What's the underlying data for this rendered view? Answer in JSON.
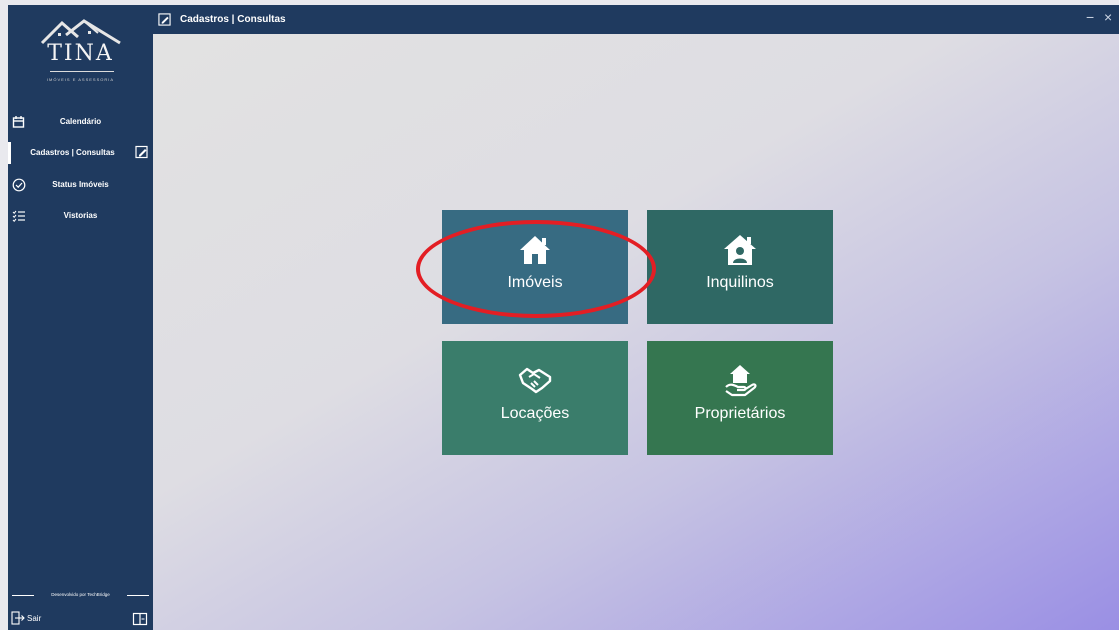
{
  "app": {
    "logo_text": "TINA",
    "logo_subtitle": "IMÓVEIS E ASSESSORIA",
    "window_title": "Cadastros | Consultas",
    "min_symbol": "−",
    "close_symbol": "×"
  },
  "sidebar": {
    "items": [
      {
        "label": "Calendário",
        "icon": "calendar-icon"
      },
      {
        "label": "Cadastros | Consultas",
        "icon": "edit-document-icon",
        "active": true
      },
      {
        "label": "Status Imóveis",
        "icon": "check-circle-icon"
      },
      {
        "label": "Vistorias",
        "icon": "checklist-icon"
      }
    ],
    "credit": "Desenvolvido por TechBridge",
    "logout_label": "Sair",
    "logout_icon": "logout-icon",
    "book_icon": "book-icon"
  },
  "tiles": [
    {
      "label": "Imóveis",
      "icon": "house-icon",
      "color": "#376b82"
    },
    {
      "label": "Inquilinos",
      "icon": "house-person-icon",
      "color": "#2f6864"
    },
    {
      "label": "Locações",
      "icon": "handshake-icon",
      "color": "#3a7d6b"
    },
    {
      "label": "Proprietários",
      "icon": "house-in-hand-icon",
      "color": "#357650"
    }
  ],
  "colors": {
    "sidebar": "#1f3a5f",
    "highlight": "#e31e24"
  }
}
